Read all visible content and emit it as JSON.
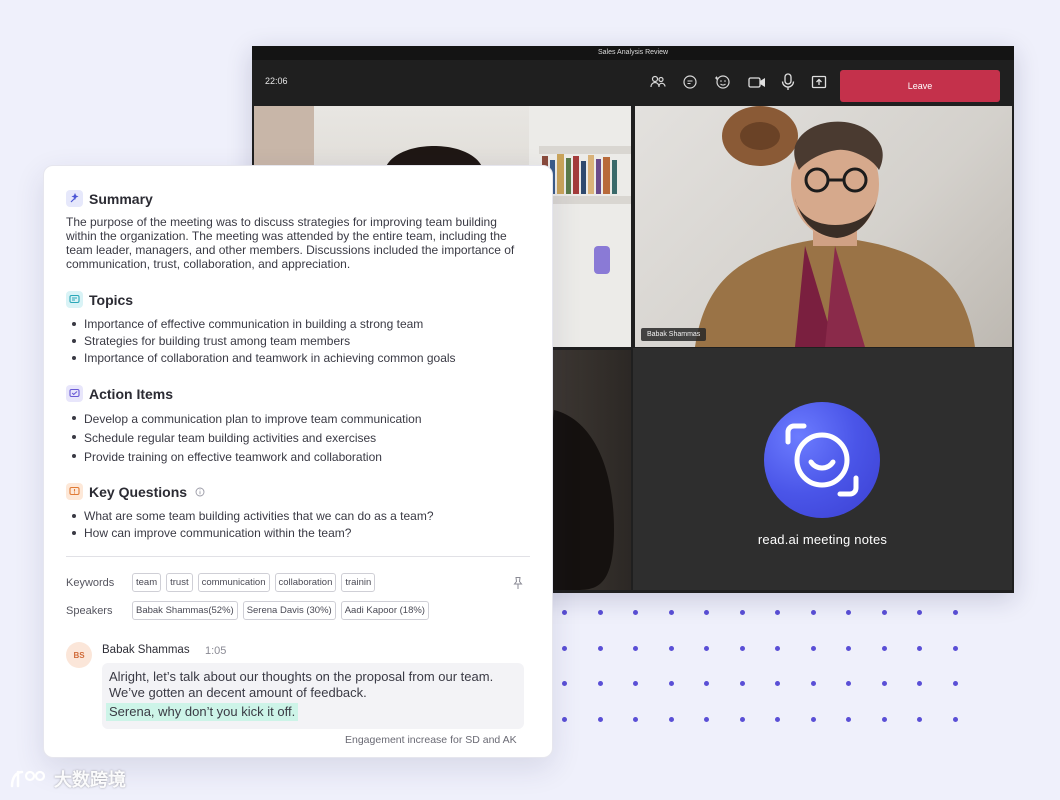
{
  "meeting": {
    "window_title": "Sales Analysis Review",
    "time": "22:06",
    "leave_label": "Leave",
    "toolbar_icons": [
      "people-icon",
      "chat-icon",
      "reactions-icon",
      "camera-icon",
      "mic-icon",
      "share-icon"
    ],
    "tiles": [
      {
        "participant": ""
      },
      {
        "participant": "Babak Shammas"
      },
      {
        "participant": ""
      },
      {
        "participant": "read.ai meeting notes"
      }
    ],
    "leave_color": "#c4314b",
    "readai_color": "#4a55e8"
  },
  "notes": {
    "summary": {
      "title": "Summary",
      "text": "The purpose of the meeting was to discuss strategies for improving team building within the organization. The meeting was attended by the entire team, including the team leader, managers, and other members. Discussions  included the importance of communication, trust, collaboration, and appreciation."
    },
    "topics": {
      "title": "Topics",
      "items": [
        "Importance of effective communication in building a strong team",
        "Strategies for building trust among team members",
        "Importance of collaboration and teamwork in achieving common goals"
      ]
    },
    "action_items": {
      "title": "Action Items",
      "items": [
        "Develop a communication plan to improve team communication",
        "Schedule regular team building activities and exercises",
        "Provide training on effective teamwork and collaboration"
      ]
    },
    "key_questions": {
      "title": "Key Questions",
      "items": [
        "What are some team building activities that we can do as a team?",
        "How can improve communication within the team?"
      ]
    },
    "keywords": {
      "label": "Keywords",
      "items": [
        "team",
        "trust",
        "communication",
        "collaboration",
        "trainin"
      ]
    },
    "speakers": {
      "label": "Speakers",
      "items": [
        "Babak Shammas(52%)",
        "Serena Davis (30%)",
        "Aadi Kapoor (18%)"
      ]
    },
    "transcript": {
      "initials": "BS",
      "name": "Babak Shammas",
      "time": "1:05",
      "line1": "Alright, let’s talk about our thoughts on the proposal from our team.",
      "line2": "We’ve gotten an decent amount of feedback.",
      "highlight": "Serena, why don’t you kick it off.",
      "footer": "Engagement increase for SD and AK"
    }
  },
  "watermark": {
    "text": "大数跨境"
  }
}
